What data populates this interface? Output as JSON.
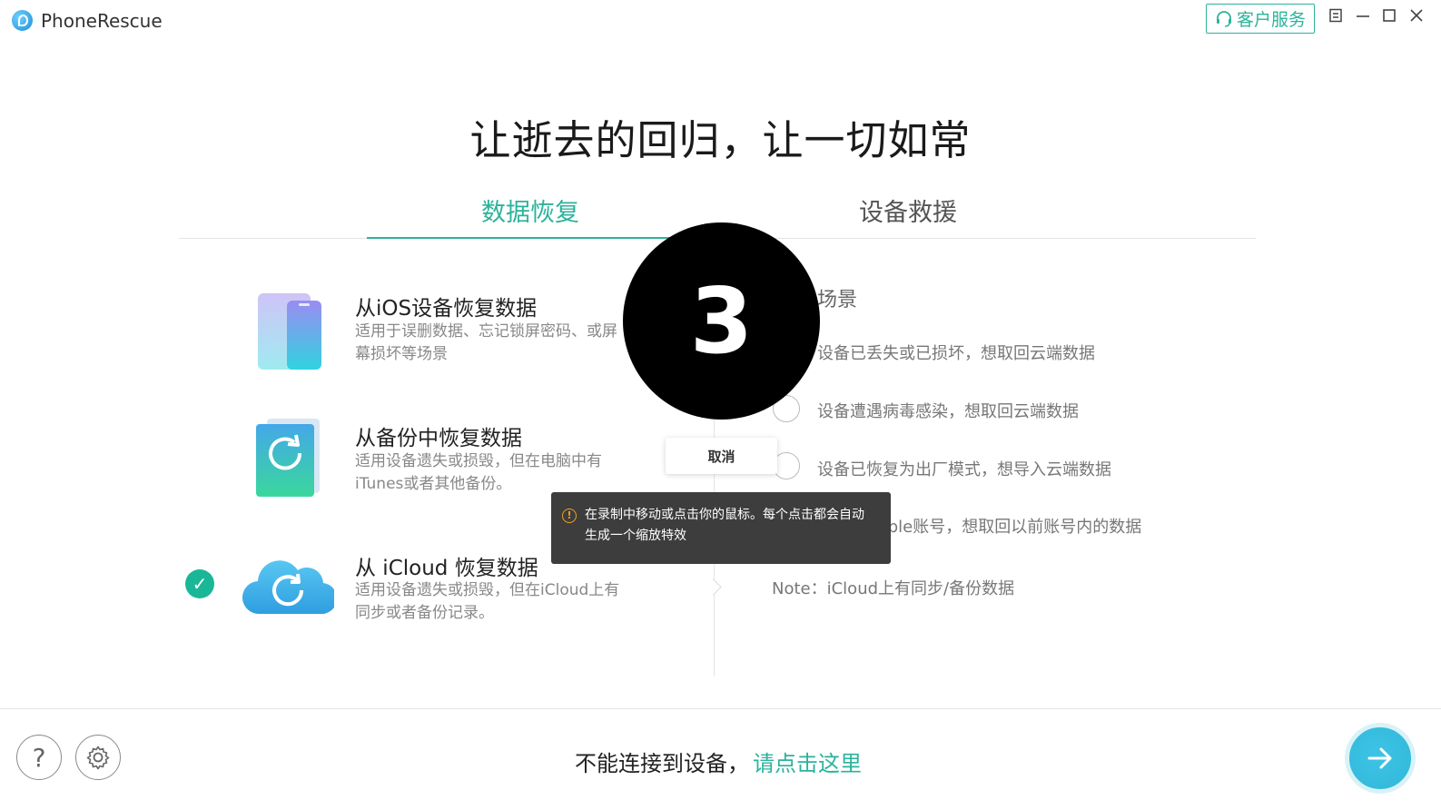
{
  "app": {
    "title": "PhoneRescue",
    "support_label": "客户服务"
  },
  "window_controls": {
    "menu": "☰",
    "minimize": "—",
    "maximize": "☐",
    "close": "✕"
  },
  "hero_title": "让逝去的回归，让一切如常",
  "tabs": [
    {
      "label": "数据恢复",
      "active": true
    },
    {
      "label": "设备救援",
      "active": false
    }
  ],
  "options": [
    {
      "title": "从iOS设备恢复数据",
      "desc": "适用于误删数据、忘记锁屏密码、或屏幕损坏等场景",
      "icon": "iphone-icon",
      "selected": false
    },
    {
      "title": "从备份中恢复数据",
      "desc": "适用设备遗失或损毁，但在电脑中有iTunes或者其他备份。",
      "icon": "backup-file-icon",
      "selected": false
    },
    {
      "title": "从 iCloud 恢复数据",
      "desc": "适用设备遗失或损毁，但在iCloud上有同步或者备份记录。",
      "icon": "icloud-icon",
      "selected": true
    }
  ],
  "scenarios": {
    "heading": "场景",
    "items": [
      {
        "text": "设备已丢失或已损坏，想取回云端数据",
        "icon": "broken-device-icon"
      },
      {
        "text": "设备遭遇病毒感染，想取回云端数据",
        "icon": "virus-icon"
      },
      {
        "text": "设备已恢复为出厂模式，想导入云端数据",
        "icon": "factory-reset-icon"
      },
      {
        "text": "更换新Apple账号，想取回以前账号内的数据",
        "icon": "account-icon"
      }
    ],
    "note": "Note：iCloud上有同步/备份数据"
  },
  "recording_overlay": {
    "countdown": "3",
    "cancel_label": "取消",
    "tooltip": "在录制中移动或点击你的鼠标。每个点击都会自动生成一个缩放特效",
    "warn_icon": "!"
  },
  "footer": {
    "help_icon": "?",
    "cannot_connect": "不能连接到设备，",
    "link": "请点击这里"
  },
  "colors": {
    "accent": "#2bb39b",
    "next_button": "#3ec3e6"
  }
}
